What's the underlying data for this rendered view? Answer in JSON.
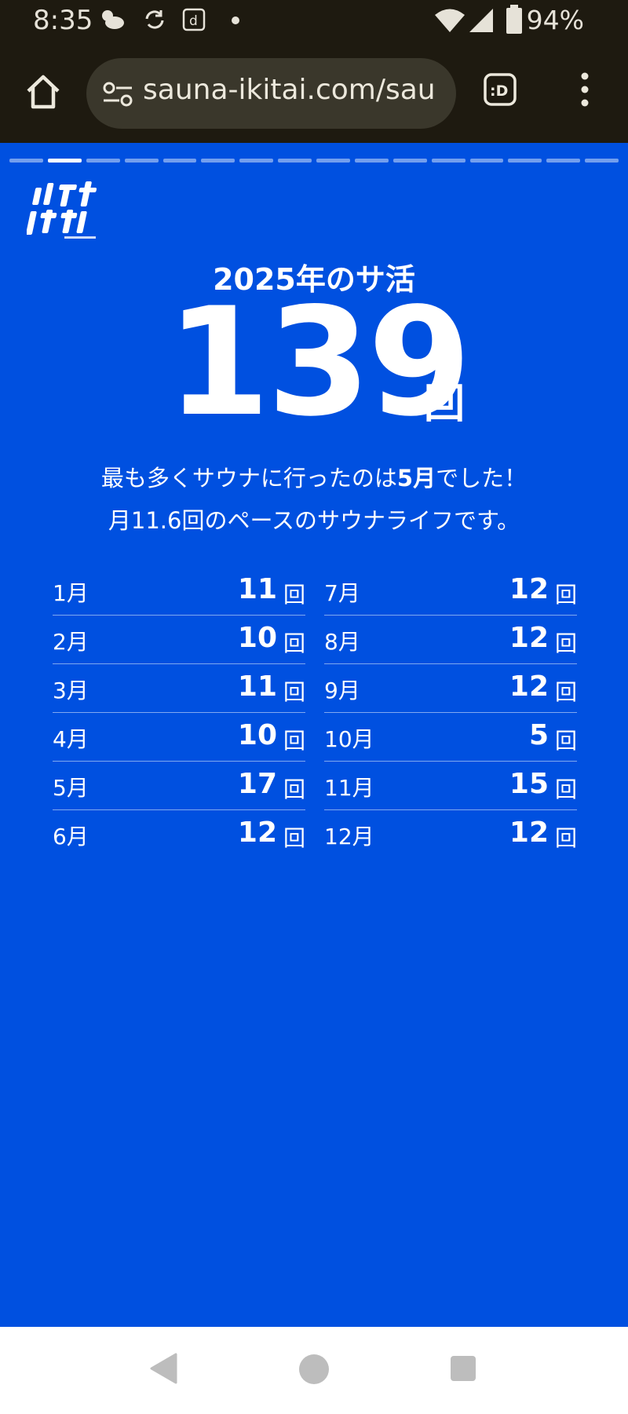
{
  "status_bar": {
    "time": "8:35",
    "battery": "94%",
    "icons": [
      "cloudy-sun-icon",
      "sync-icon",
      "d-app-icon",
      "dot-icon",
      "wifi-icon",
      "signal-icon",
      "battery-icon"
    ]
  },
  "browser": {
    "url": "sauna-ikitai.com/sau"
  },
  "story": {
    "progress_segments": 16,
    "active_segment": 1,
    "headline": "2025年のサ活",
    "total_count": "139",
    "total_unit": "回",
    "summary_line1_prefix": "最も多くサウナに行ったのは",
    "summary_line1_highlight": "5月",
    "summary_line1_suffix": "でした！",
    "summary_line2": "月11.6回のペースのサウナライフです。",
    "unit": "回",
    "months_left": [
      {
        "name": "1月",
        "count": "11"
      },
      {
        "name": "2月",
        "count": "10"
      },
      {
        "name": "3月",
        "count": "11"
      },
      {
        "name": "4月",
        "count": "10"
      },
      {
        "name": "5月",
        "count": "17"
      },
      {
        "name": "6月",
        "count": "12"
      }
    ],
    "months_right": [
      {
        "name": "7月",
        "count": "12"
      },
      {
        "name": "8月",
        "count": "12"
      },
      {
        "name": "9月",
        "count": "12"
      },
      {
        "name": "10月",
        "count": "5"
      },
      {
        "name": "11月",
        "count": "15"
      },
      {
        "name": "12月",
        "count": "12"
      }
    ]
  },
  "colors": {
    "story_background": "#0050e0",
    "chrome_background": "#1e1a10"
  }
}
